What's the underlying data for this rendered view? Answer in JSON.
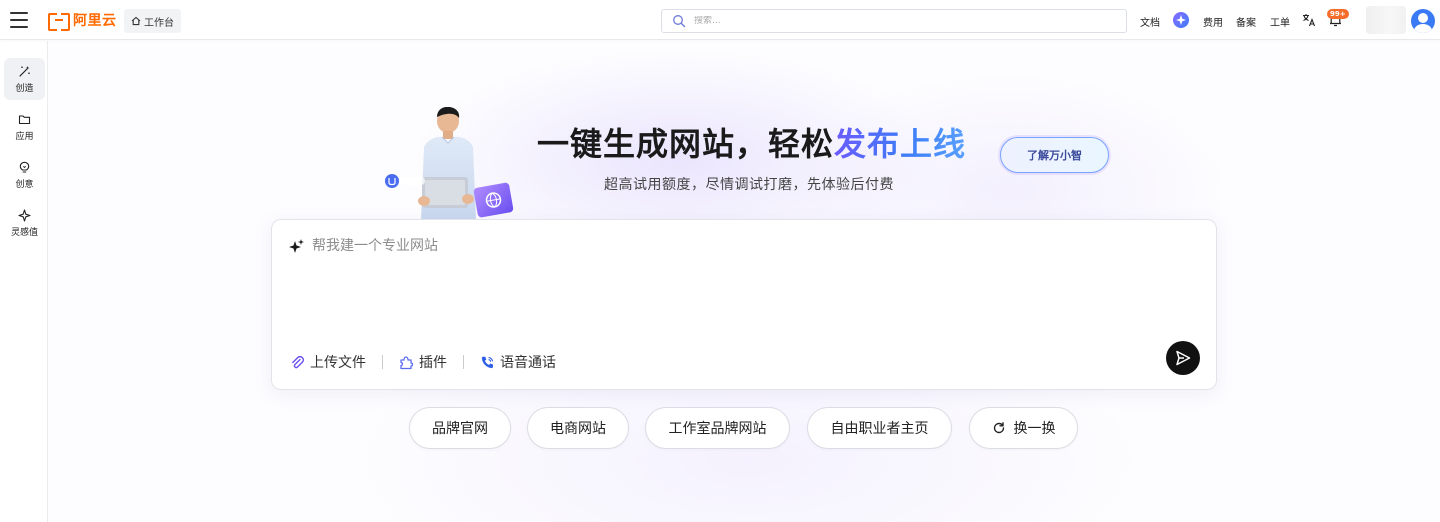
{
  "topbar": {
    "brand": "阿里云",
    "workbench_label": "工作台",
    "search_placeholder": "搜索...",
    "links": {
      "docs": "文档",
      "billing": "费用",
      "filing": "备案",
      "ticket": "工单"
    },
    "notification_badge": "99+"
  },
  "sidebar": {
    "items": [
      {
        "label": "创造",
        "icon": "magic-wand-icon",
        "active": true
      },
      {
        "label": "应用",
        "icon": "folder-icon"
      },
      {
        "label": "创意",
        "icon": "lightbulb-icon"
      },
      {
        "label": "灵感值",
        "icon": "sparkle-icon"
      }
    ]
  },
  "hero": {
    "headline_plain": "一键生成网站，轻松",
    "headline_highlight": "发布上线",
    "subheadline": "超高试用额度，尽情调试打磨，先体验后付费",
    "learn_more": "了解万小智"
  },
  "prompt": {
    "placeholder": "帮我建一个专业网站",
    "upload": "上传文件",
    "plugin": "插件",
    "voice": "语音通话"
  },
  "suggestions": {
    "items": [
      "品牌官网",
      "电商网站",
      "工作室品牌网站",
      "自由职业者主页"
    ],
    "refresh": "换一换"
  },
  "colors": {
    "brand_orange": "#ff6a00",
    "accent_blue": "#3d7cf6",
    "accent_purple": "#6b5bff",
    "send_button": "#111111"
  }
}
